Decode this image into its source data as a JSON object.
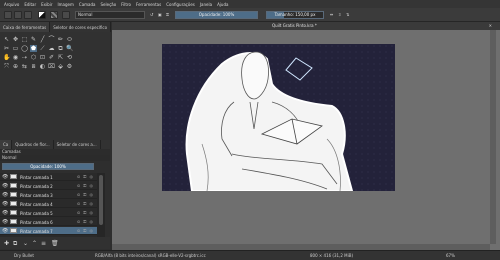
{
  "menu": [
    "Arquivo",
    "Editar",
    "Exibir",
    "Imagem",
    "Camada",
    "Seleção",
    "Filtro",
    "Ferramentas",
    "Configurações",
    "Janela",
    "Ajuda"
  ],
  "toolbar": {
    "blend_mode": "Normal",
    "opacity_label": "Opacidade: 100%",
    "opacity_value": 1.0,
    "size_label": "Tamanho: 150,00 px",
    "size_value": 0.3
  },
  "left_dock": {
    "tabs": [
      "Caixa de ferramentas",
      "Seletor de cores específico"
    ],
    "tools": [
      "↖",
      "✥",
      "⬚",
      "✎",
      "╱",
      "⌒",
      "✏",
      "⬭",
      "✂",
      "▭",
      "◯",
      "⬟",
      "⟋",
      "☁",
      "⧉",
      "🔍",
      "✋",
      "◉",
      "⇢",
      "⬡",
      "⊡",
      "✐",
      "⇱",
      "⟲",
      "⤧",
      "⊕",
      "⇆",
      "⧈",
      "◐",
      "⌧",
      "⬙",
      "⚙"
    ]
  },
  "layers": {
    "tabs": [
      "Ca",
      "Quadros de flor...",
      "Seletor de cores a..."
    ],
    "header": "Camadas",
    "blend": "Normal",
    "opacity_label": "Opacidade: 100%",
    "rows": [
      {
        "name": "Pintar camada 1"
      },
      {
        "name": "Pintar camada 2"
      },
      {
        "name": "Pintar camada 3"
      },
      {
        "name": "Pintar camada 4"
      },
      {
        "name": "Pintar camada 5"
      },
      {
        "name": "Pintar camada 6"
      },
      {
        "name": "Pintar camada 7"
      }
    ],
    "selected_index": 6
  },
  "document": {
    "tab_title": "Quilt Gratis Pinto.kra *",
    "close": "✕"
  },
  "status": {
    "left": "Dry Bullet",
    "color_space": "RGB/Alfa (8 bits inteiros/canal) sRGB-elle-V2-srgbtrc.icc",
    "dimensions": "800 × 416 (31,2 MiB)",
    "zoom": "67%"
  }
}
